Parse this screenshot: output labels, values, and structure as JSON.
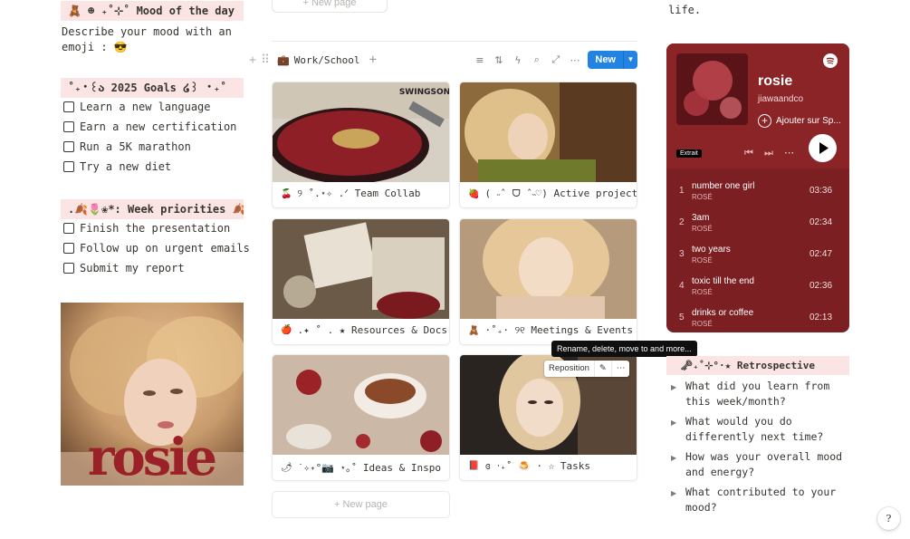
{
  "left": {
    "mood_callout": "🧸 ☻ ₊˚⊹˚ Mood of the day",
    "mood_text": "Describe your mood with an emoji : 😎",
    "goals_callout": "˚₊‧꒰ა 2025 Goals ໒꒱ ‧₊˚",
    "goals": [
      "Learn a new language",
      "Earn a new certification",
      "Run a 5K marathon",
      "Try a new diet"
    ],
    "priorities_callout": ".🍂🌷❀*: Week priorities 🍂",
    "priorities": [
      "Finish the presentation",
      "Follow up on urgent emails",
      "Submit my report"
    ],
    "image_text": "rosie"
  },
  "gallery": {
    "top_new_page": "+ New page",
    "view_name": "Work/School",
    "view_icon": "briefcase-icon",
    "new_button": "New",
    "cards": [
      {
        "emoji": "🍒",
        "title": "୨ ˚.⋆✧ .ᐟ Team Collab",
        "cover_text": "SWINGSON"
      },
      {
        "emoji": "🍓",
        "title": "( ˶ˆ ᗜ ˆ˵♡) Active projects"
      },
      {
        "emoji": "🍎",
        "title": ".✦ ˚ . ★ Resources & Docs"
      },
      {
        "emoji": "🧸",
        "title": "·˚₊· ୨୧ Meetings & Events"
      },
      {
        "emoji": "🌶",
        "title": "˙✧˖°📷 ⋆｡˚ Ideas & Inspo"
      },
      {
        "emoji": "📕",
        "title": "ɞ ‧₊˚ 🍮 · ☆ Tasks"
      }
    ],
    "bottom_new_page": "+ New page",
    "tooltip": "Rename, delete, move to and more...",
    "reposition": "Reposition"
  },
  "right": {
    "top_text": "life.",
    "player": {
      "title": "rosie",
      "artist": "jiawaandco",
      "add_label": "Ajouter sur Sp...",
      "badge": "Extrait",
      "tracks": [
        {
          "n": "1",
          "name": "number one girl",
          "artist": "ROSÉ",
          "dur": "03:36"
        },
        {
          "n": "2",
          "name": "3am",
          "artist": "ROSÉ",
          "dur": "02:34"
        },
        {
          "n": "3",
          "name": "two years",
          "artist": "ROSÉ",
          "dur": "02:47"
        },
        {
          "n": "4",
          "name": "toxic till the end",
          "artist": "ROSÉ",
          "dur": "02:36"
        },
        {
          "n": "5",
          "name": "drinks or coffee",
          "artist": "ROSÉ",
          "dur": "02:13"
        }
      ]
    },
    "retro_callout": "🗝₊˚⊹°·★ Retrospective",
    "questions": [
      "What did you learn from this week/month?",
      "What would you do differently next time?",
      "How was your overall mood and energy?",
      "What contributed to your mood?"
    ],
    "help": "?"
  },
  "colors": {
    "callout_bg": "#fbe4e4",
    "accent_blue": "#2383e2",
    "player_bg": "#7c1f22"
  }
}
